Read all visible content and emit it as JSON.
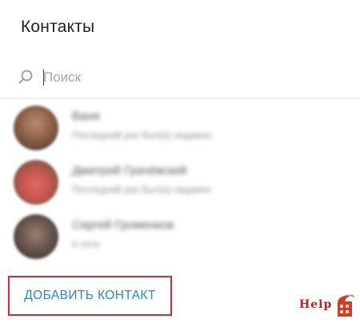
{
  "dialog": {
    "title": "Контакты"
  },
  "search": {
    "placeholder": "Поиск",
    "value": ""
  },
  "contacts": [
    {
      "name": "Ваня",
      "subtitle": "Последний раз был(а) недавно"
    },
    {
      "name": "Дмитрий Грачёвский",
      "subtitle": "Последний раз был(а) недавно"
    },
    {
      "name": "Сергей Громенков",
      "subtitle": "в сети"
    }
  ],
  "actions": {
    "add_contact_label": "ДОБАВИТЬ КОНТАКТ"
  },
  "watermark": {
    "text": "Help"
  },
  "colors": {
    "accent": "#2a86c8",
    "highlight_border": "#e0282e",
    "watermark": "#c2201c"
  },
  "icons": {
    "search": "search-icon",
    "watermark_logo": "help-logo-icon"
  }
}
